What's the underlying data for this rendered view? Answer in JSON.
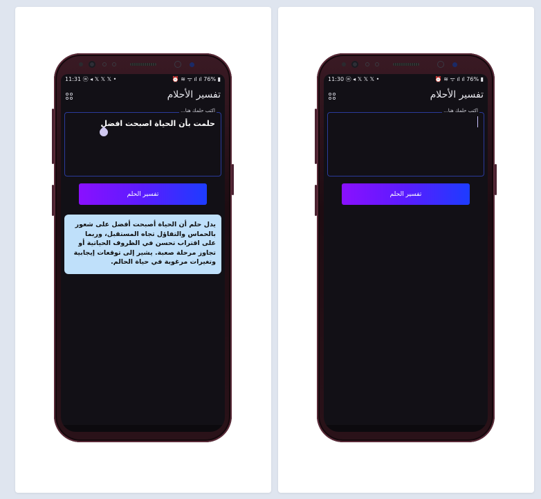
{
  "screens": [
    {
      "status": {
        "time_icons": "11:31 ⓦ ◂ 𝕏 𝕏 𝕏 •",
        "right_icons": "⏰ ≋ ᯤ ıl ıl 76% ▮"
      },
      "app_title": "تفسير الأحلام",
      "input": {
        "label": "اكتب حلمك هنا...",
        "value": "حلمت بأن الحياة اصبحت افضل"
      },
      "button_label": "تفسير الحلم",
      "result": {
        "lines": [
          "يدل حلم أن الحياة أصبحت أفضل على شعور",
          "بالحماس والتفاؤل تجاه المستقبل، وربما",
          "على اقتراب تحسن في الظروف الحياتية  أو",
          "تجاوز مرحلة صعبة.  يشير إلى توقعات إيجابية",
          "وتغيرات مرغوبة في حياة الحالم."
        ]
      }
    },
    {
      "status": {
        "time_icons": "11:30 ⓦ ◂ 𝕏 𝕏 𝕏 •",
        "right_icons": "⏰ ≋ ᯤ ıl ıl 76% ▮"
      },
      "app_title": "تفسير الأحلام",
      "input": {
        "label": "اكتب حلمك هنا...",
        "value": ""
      },
      "button_label": "تفسير الحلم"
    }
  ],
  "icons": {
    "menu": "grid-dots-icon",
    "drop": "text-selection-handle-icon"
  },
  "colors": {
    "screen_bg": "#121016",
    "field_border": "#2b3a9c",
    "button_gradient_start": "#8a10ff",
    "button_gradient_end": "#1d3cff",
    "result_bg": "#bfe0fa"
  }
}
